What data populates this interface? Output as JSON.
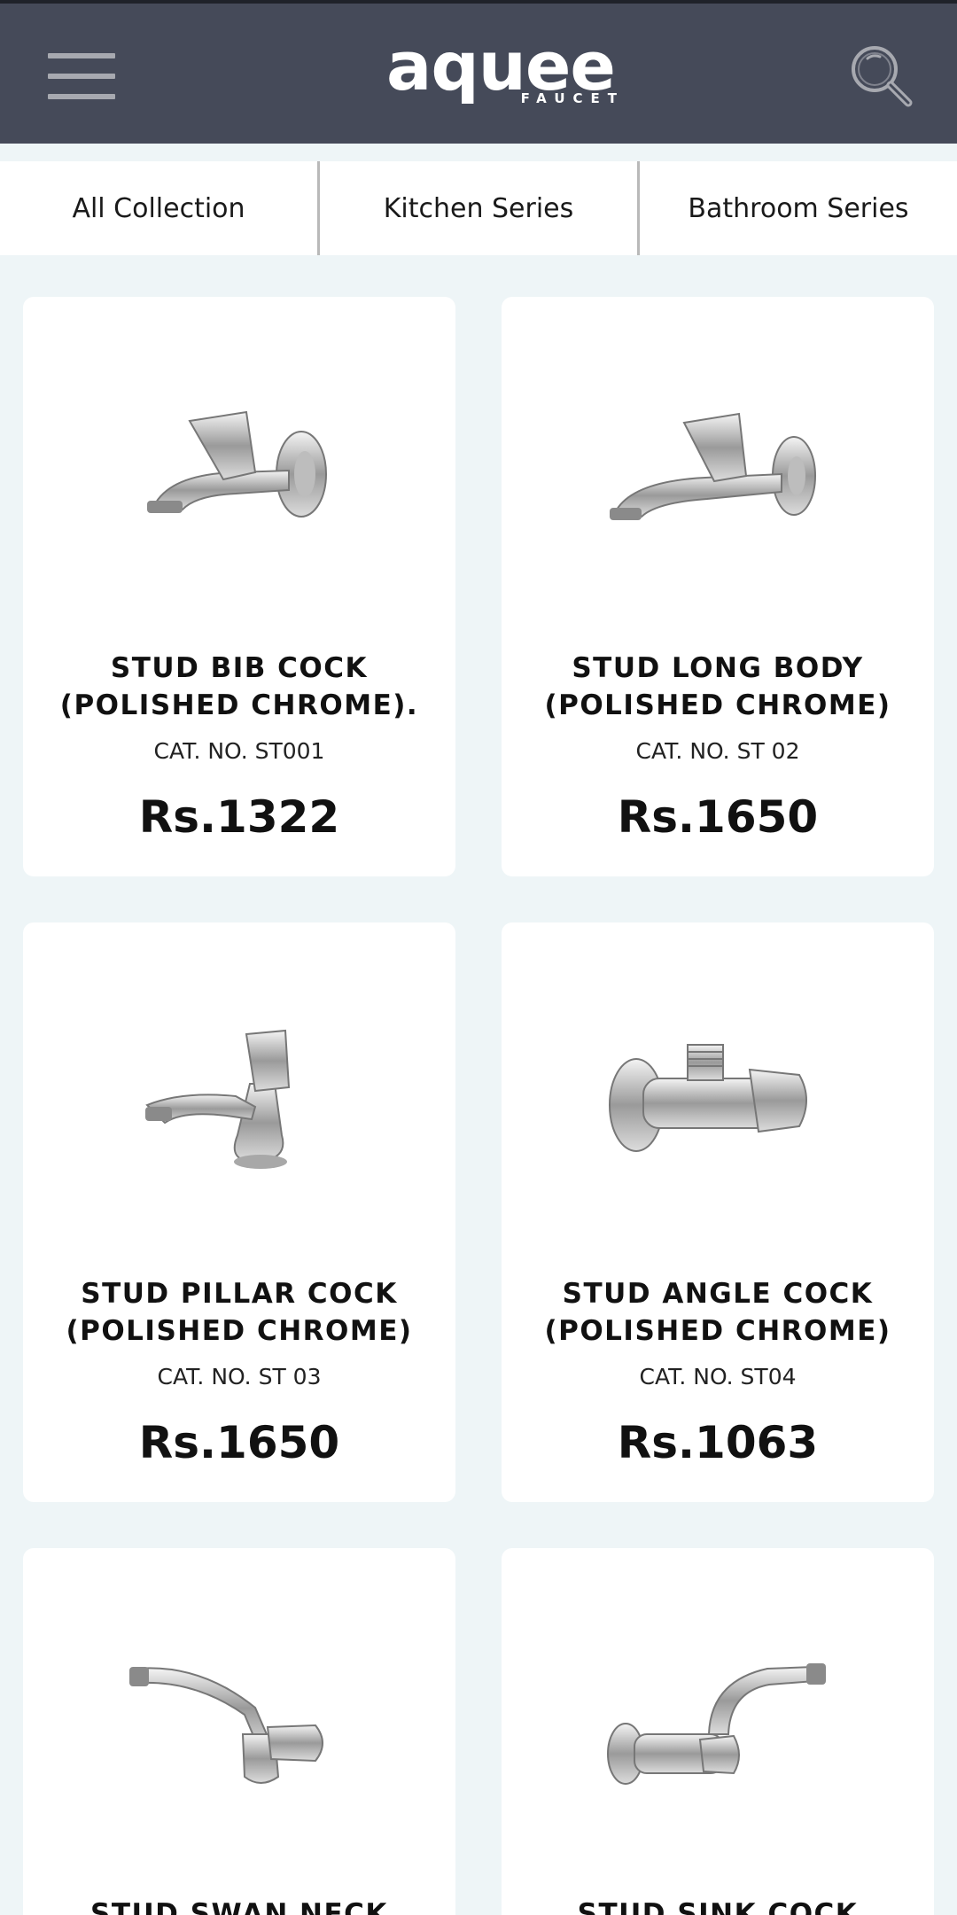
{
  "header": {
    "logo_main": "aquee",
    "logo_sub": "FAUCET"
  },
  "tabs": [
    {
      "label": "All Collection"
    },
    {
      "label": "Kitchen Series"
    },
    {
      "label": "Bathroom Series"
    }
  ],
  "products": [
    {
      "name_line1": "STUD BIB COCK",
      "name_line2": "(POLISHED CHROME).",
      "cat": "CAT. NO. ST001",
      "price": "Rs.1322"
    },
    {
      "name_line1": "STUD LONG BODY",
      "name_line2": "(POLISHED CHROME)",
      "cat": "CAT. NO. ST 02",
      "price": "Rs.1650"
    },
    {
      "name_line1": "STUD PILLAR COCK",
      "name_line2": "(POLISHED CHROME)",
      "cat": "CAT. NO. ST 03",
      "price": "Rs.1650"
    },
    {
      "name_line1": "STUD ANGLE COCK",
      "name_line2": "(POLISHED CHROME)",
      "cat": "CAT. NO. ST04",
      "price": "Rs.1063"
    },
    {
      "name_line1": "STUD SWAN NECK"
    },
    {
      "name_line1": "STUD SINK COCK"
    }
  ],
  "colors": {
    "header_bg": "#454a59",
    "page_bg": "#eef5f7",
    "card_bg": "#ffffff"
  },
  "icons": {
    "menu": "hamburger-menu-icon",
    "search": "magnifier-icon"
  }
}
